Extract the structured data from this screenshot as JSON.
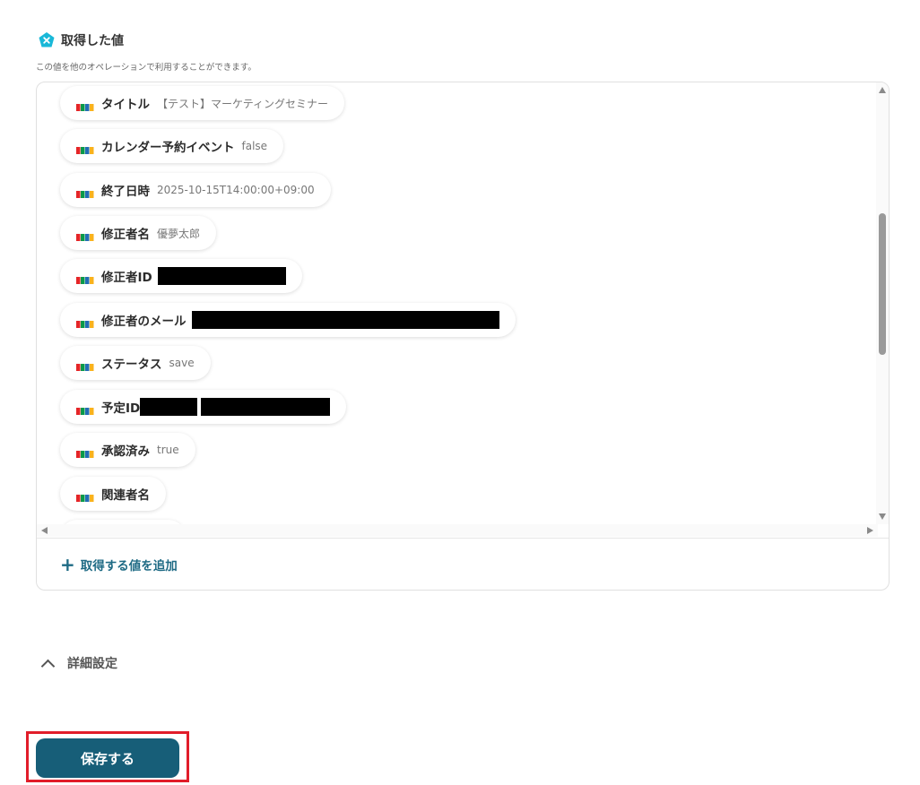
{
  "section": {
    "title": "取得した値",
    "description": "この値を他のオペレーションで利用することができます。"
  },
  "chips": [
    {
      "label": "タイトル",
      "value": "【テスト】マーケティングセミナー"
    },
    {
      "label": "カレンダー予約イベント",
      "value": "false"
    },
    {
      "label": "終了日時",
      "value": "2025-10-15T14:00:00+09:00"
    },
    {
      "label": "修正者名",
      "value": "優夢太郎"
    },
    {
      "label": "修正者ID",
      "value": ""
    },
    {
      "label": "修正者のメール",
      "value": ""
    },
    {
      "label": "ステータス",
      "value": "save"
    },
    {
      "label": "予定ID",
      "value": ""
    },
    {
      "label": "承認済み",
      "value": "true"
    },
    {
      "label": "関連者名",
      "value": ""
    }
  ],
  "add_value_label": "取得する値を追加",
  "advanced_settings_label": "詳細設定",
  "save_button_label": "保存する",
  "colors": {
    "accent": "#175e78",
    "link": "#1e6a84",
    "highlight_frame": "#e11d2a",
    "badge": "#19b8d8"
  },
  "icons": {
    "section_badge": "x-badge-icon",
    "chip_logo": "zoho-logo-icon",
    "add": "plus-icon",
    "advanced_toggle": "chevron-up-icon"
  }
}
